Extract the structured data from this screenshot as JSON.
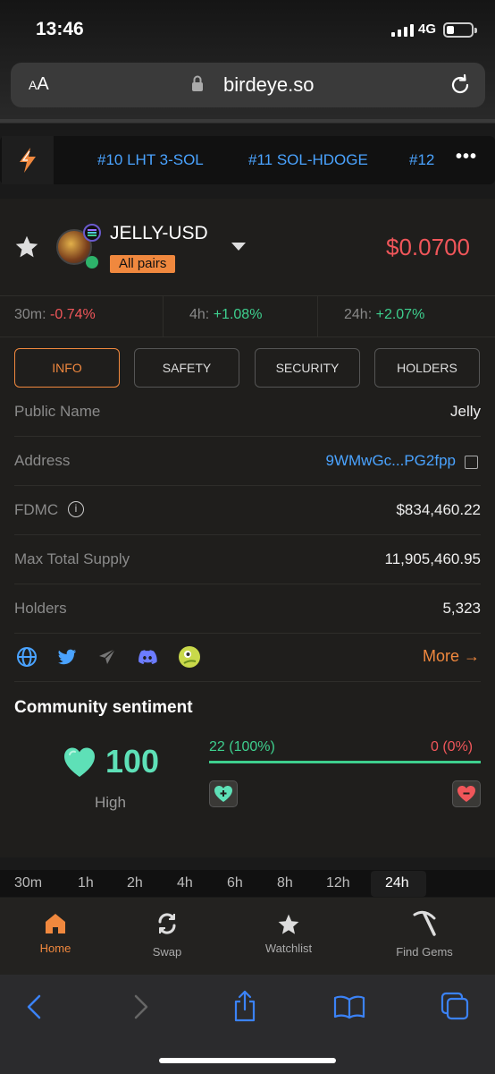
{
  "status": {
    "time": "13:46",
    "network": "4G"
  },
  "browser": {
    "aa_small": "A",
    "aa_large": "A",
    "url": "birdeye.so"
  },
  "ticker": {
    "items": [
      "#10 LHT 3-SOL",
      "#11 SOL-HDOGE",
      "#12"
    ],
    "more": "•••"
  },
  "token": {
    "pair": "JELLY-USD",
    "all_pairs": "All pairs",
    "price": "$0.0700"
  },
  "changes": [
    {
      "label": "30m:",
      "value": "-0.74%"
    },
    {
      "label": "4h:",
      "value": "+1.08%"
    },
    {
      "label": "24h:",
      "value": "+2.07%"
    }
  ],
  "tabs": [
    "INFO",
    "SAFETY",
    "SECURITY",
    "HOLDERS"
  ],
  "info": {
    "public_name_label": "Public Name",
    "public_name": "Jelly",
    "address_label": "Address",
    "address": "9WMwGc...PG2fpp",
    "fdmc_label": "FDMC",
    "fdmc": "$834,460.22",
    "supply_label": "Max Total Supply",
    "supply": "11,905,460.95",
    "holders_label": "Holders",
    "holders": "5,323"
  },
  "links": {
    "more": "More →"
  },
  "sentiment": {
    "title": "Community sentiment",
    "score": "100",
    "level": "High",
    "positive": "22 (100%)",
    "negative": "0 (0%)"
  },
  "timeframes": [
    "30m",
    "1h",
    "2h",
    "4h",
    "6h",
    "8h",
    "12h",
    "24h"
  ],
  "nav": [
    "Home",
    "Swap",
    "Watchlist",
    "Find Gems"
  ],
  "colors": {
    "accent": "#f0883e",
    "up": "#3ecf8e",
    "down": "#f0565a",
    "link": "#4aa3ff"
  }
}
